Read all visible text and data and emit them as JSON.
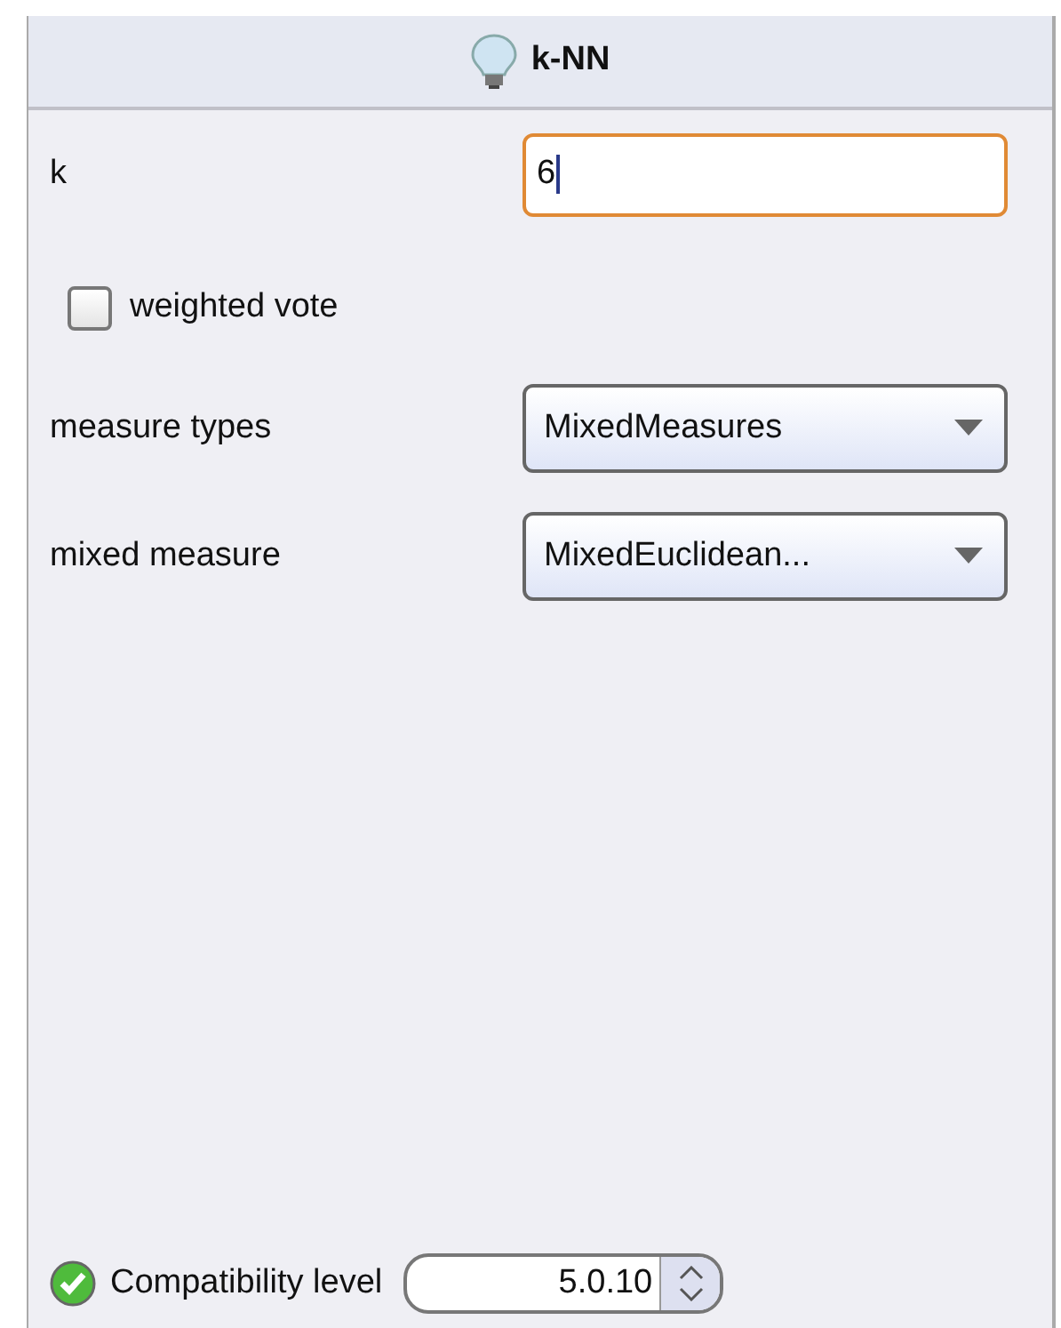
{
  "panel": {
    "title": "k-NN"
  },
  "parameters": [
    {
      "kind": "text",
      "label": "k",
      "value": "6",
      "focused": true
    },
    {
      "kind": "checkbox",
      "label": "weighted vote",
      "checked": false
    },
    {
      "kind": "select",
      "label": "measure types",
      "value": "MixedMeasures"
    },
    {
      "kind": "select",
      "label": "mixed measure",
      "value": "MixedEuclidean..."
    }
  ],
  "compatibility": {
    "label": "Compatibility level",
    "value": "5.0.10",
    "ok": true
  }
}
